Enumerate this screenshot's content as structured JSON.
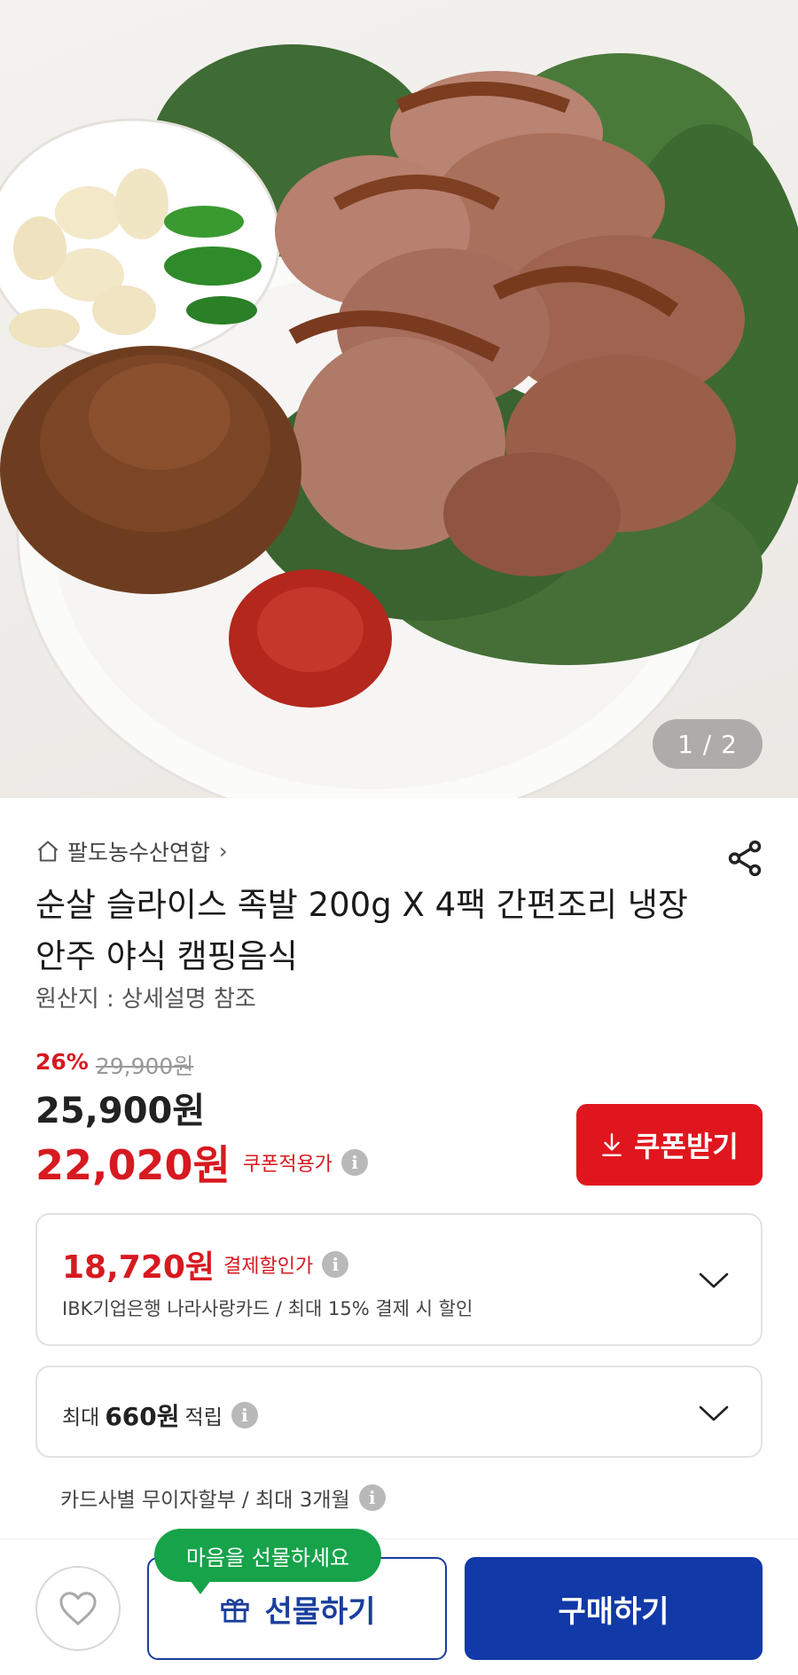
{
  "hero": {
    "counter": "1 / 2"
  },
  "product": {
    "seller": "팔도농수산연합",
    "title": "순살 슬라이스 족발 200g X 4팩 간편조리 냉장 안주 야식 캠핑음식",
    "origin": "원산지 : 상세설명 참조",
    "discount_rate": "26%",
    "original_price": "29,900원",
    "price": "25,900원",
    "coupon_price": "22,020원",
    "coupon_price_label": "쿠폰적용가",
    "coupon_button": "쿠폰받기"
  },
  "payment_card": {
    "price": "18,720원",
    "label": "결제할인가",
    "description": "IBK기업은행 나라사랑카드 / 최대 15% 결제 시 할인"
  },
  "points_card": {
    "prefix": "최대",
    "amount": "660원",
    "suffix": "적립"
  },
  "installment": "카드사별 무이자할부 / 최대 3개월",
  "bottom_bar": {
    "tooltip": "마음을 선물하세요",
    "gift_label": "선물하기",
    "buy_label": "구매하기"
  },
  "colors": {
    "accent_red": "#d71920",
    "coupon_button": "#e0161e",
    "buy_button": "#1239a8",
    "tooltip_green": "#16a34a"
  },
  "icons": [
    "home-icon",
    "share-icon",
    "download-arrow-icon",
    "info-icon",
    "chevron-down-icon",
    "heart-icon",
    "gift-icon"
  ]
}
